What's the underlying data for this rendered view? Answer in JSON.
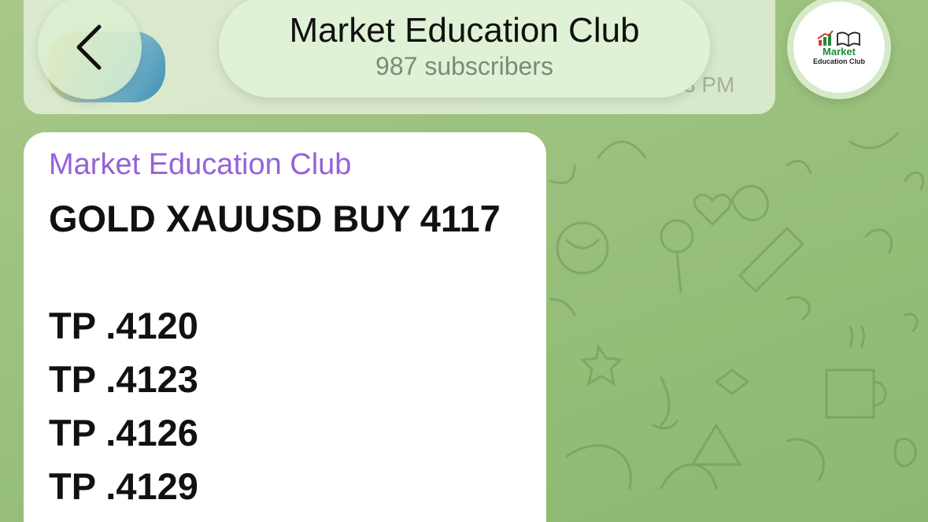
{
  "header": {
    "channel_name": "Market Education Club",
    "subscribers": "987 subscribers"
  },
  "previous_message": {
    "time_fragment": "3 PM"
  },
  "avatar": {
    "logo_line1": "Market",
    "logo_line2": "Education Club"
  },
  "message": {
    "sender": "Market Education Club",
    "lines": [
      "GOLD XAUUSD BUY 4117",
      "",
      "TP .4120",
      "TP .4123",
      "TP .4126",
      "TP .4129"
    ]
  },
  "colors": {
    "sender_name": "#9562d8",
    "chat_background": "#9cc27f",
    "logo_green": "#1f8a3b",
    "logo_red": "#d33a2c"
  }
}
